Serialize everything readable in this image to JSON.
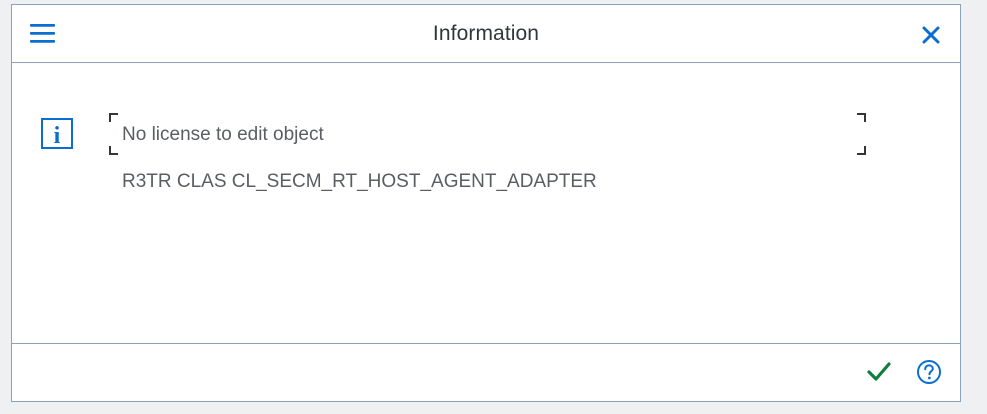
{
  "dialog": {
    "title": "Information",
    "message": "No license to edit object",
    "detail": "R3TR CLAS CL_SECM_RT_HOST_AGENT_ADAPTER"
  },
  "icons": {
    "menu": "hamburger-menu-icon",
    "close": "close-icon",
    "info": "info-icon",
    "ok": "checkmark-icon",
    "help": "help-icon"
  },
  "colors": {
    "accent_blue": "#0a6ed1",
    "ok_green": "#107e3e",
    "border": "#8aa3b8",
    "text": "#32363a"
  }
}
